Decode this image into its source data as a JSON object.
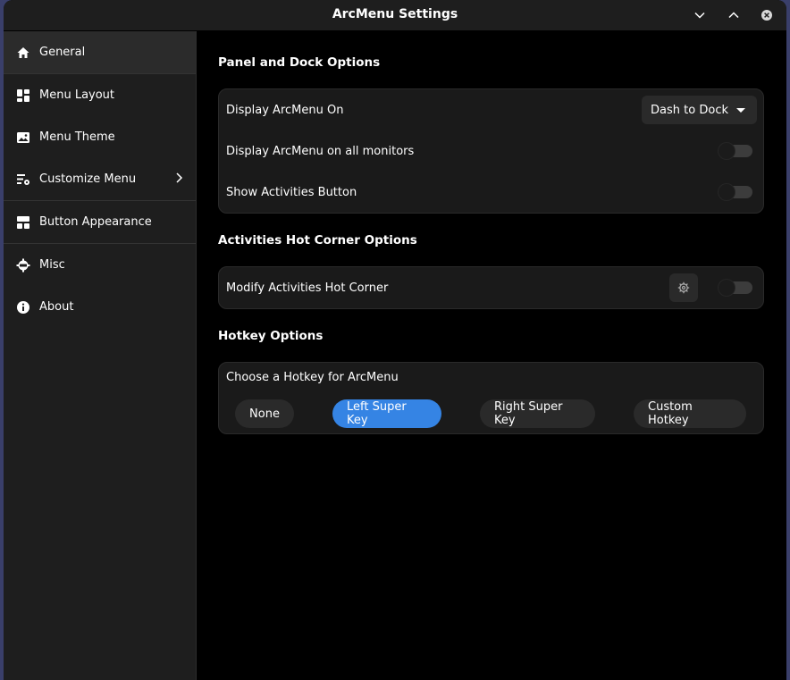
{
  "window": {
    "title": "ArcMenu Settings"
  },
  "sidebar": {
    "items": [
      {
        "label": "General",
        "icon": "home-icon"
      },
      {
        "label": "Menu Layout",
        "icon": "layout-icon"
      },
      {
        "label": "Menu Theme",
        "icon": "theme-icon"
      },
      {
        "label": "Customize Menu",
        "icon": "customize-icon"
      },
      {
        "label": "Button Appearance",
        "icon": "button-appearance-icon"
      },
      {
        "label": "Misc",
        "icon": "misc-icon"
      },
      {
        "label": "About",
        "icon": "info-icon"
      }
    ]
  },
  "panel_dock": {
    "title": "Panel and Dock Options",
    "display_on_label": "Display ArcMenu On",
    "display_on_value": "Dash to Dock",
    "all_monitors_label": "Display ArcMenu on all monitors",
    "all_monitors_enabled": false,
    "activities_button_label": "Show Activities Button",
    "activities_button_enabled": false
  },
  "hot_corner": {
    "title": "Activities Hot Corner Options",
    "modify_label": "Modify Activities Hot Corner",
    "modify_enabled": false
  },
  "hotkey": {
    "title": "Hotkey Options",
    "choose_label": "Choose a Hotkey for ArcMenu",
    "options": [
      "None",
      "Left Super Key",
      "Right Super Key",
      "Custom Hotkey"
    ],
    "selected": "Left Super Key"
  },
  "colors": {
    "accent": "#3584e4",
    "window_bg": "#000000",
    "sidebar_bg": "#1e1e1e",
    "card_bg": "#1a1a1a"
  }
}
